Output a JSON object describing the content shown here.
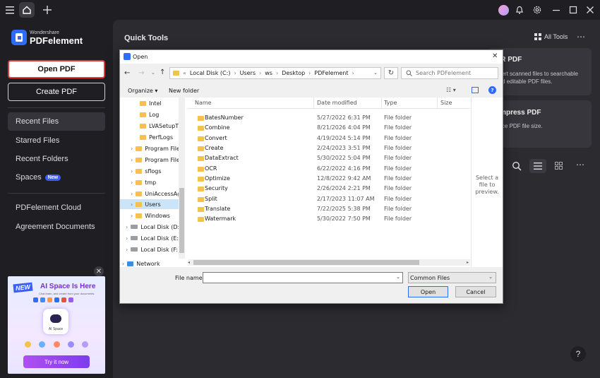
{
  "app": {
    "brand_small": "Wondershare",
    "brand_name": "PDFelement"
  },
  "sidebar": {
    "open_pdf": "Open PDF",
    "create_pdf": "Create PDF",
    "items": [
      {
        "label": "Recent Files"
      },
      {
        "label": "Starred Files"
      },
      {
        "label": "Recent Folders"
      },
      {
        "label": "Spaces"
      }
    ],
    "spaces_badge": "New",
    "items2": [
      {
        "label": "PDFelement Cloud"
      },
      {
        "label": "Agreement Documents"
      }
    ]
  },
  "promo": {
    "new_badge": "NEW",
    "title": "AI Space Is Here",
    "subtitle": "Chat learn, and create from your documents.",
    "center_label": "AI Space",
    "cta": "Try it now"
  },
  "main": {
    "quick_tools": "Quick Tools",
    "all_tools": "All Tools",
    "ocr_title": "CR PDF",
    "ocr_desc": "nvert scanned files to searchable and editable PDF files.",
    "compress_title": "ompress PDF",
    "compress_desc": "duce PDF file size."
  },
  "dialog": {
    "title": "Open",
    "breadcrumb": [
      "Local Disk (C:)",
      "Users",
      "ws",
      "Desktop",
      "PDFelement"
    ],
    "search_placeholder": "Search PDFelement",
    "organize": "Organize",
    "new_folder": "New folder",
    "columns": {
      "name": "Name",
      "date": "Date modified",
      "type": "Type",
      "size": "Size"
    },
    "tree": [
      {
        "label": "Intel",
        "kind": "folder",
        "expand": false
      },
      {
        "label": "Log",
        "kind": "folder",
        "expand": false
      },
      {
        "label": "LVASetupTm",
        "kind": "folder",
        "expand": false
      },
      {
        "label": "PerfLogs",
        "kind": "folder",
        "expand": false
      },
      {
        "label": "Program File",
        "kind": "folder",
        "expand": true
      },
      {
        "label": "Program File",
        "kind": "folder",
        "expand": true
      },
      {
        "label": "sflogs",
        "kind": "folder",
        "expand": true
      },
      {
        "label": "tmp",
        "kind": "folder",
        "expand": true
      },
      {
        "label": "UniAccessAg",
        "kind": "folder",
        "expand": true
      },
      {
        "label": "Users",
        "kind": "folder",
        "expand": true
      },
      {
        "label": "Windows",
        "kind": "folder",
        "expand": true
      },
      {
        "label": "Local Disk (D:",
        "kind": "drive",
        "expand": true
      },
      {
        "label": "Local Disk (E:)",
        "kind": "drive",
        "expand": true
      },
      {
        "label": "Local Disk (F:)",
        "kind": "drive",
        "expand": true
      },
      {
        "label": "Network",
        "kind": "network",
        "expand": true
      }
    ],
    "files": [
      {
        "name": "BatesNumber",
        "date": "5/27/2022 6:31 PM",
        "type": "File folder"
      },
      {
        "name": "Combine",
        "date": "8/21/2026 4:04 PM",
        "type": "File folder"
      },
      {
        "name": "Convert",
        "date": "4/19/2024 5:14 PM",
        "type": "File folder"
      },
      {
        "name": "Create",
        "date": "2/24/2023 3:51 PM",
        "type": "File folder"
      },
      {
        "name": "DataExtract",
        "date": "5/30/2022 5:04 PM",
        "type": "File folder"
      },
      {
        "name": "OCR",
        "date": "6/22/2022 4:16 PM",
        "type": "File folder"
      },
      {
        "name": "Optimize",
        "date": "12/8/2022 9:42 AM",
        "type": "File folder"
      },
      {
        "name": "Security",
        "date": "2/26/2024 2:21 PM",
        "type": "File folder"
      },
      {
        "name": "Split",
        "date": "2/17/2023 11:07 AM",
        "type": "File folder"
      },
      {
        "name": "Translate",
        "date": "7/22/2025 5:38 PM",
        "type": "File folder"
      },
      {
        "name": "Watermark",
        "date": "5/30/2022 7:50 PM",
        "type": "File folder"
      }
    ],
    "preview_hint": "Select a file to preview.",
    "file_name_label": "File name:",
    "file_name_value": "",
    "filter": "Common Files",
    "open_btn": "Open",
    "cancel_btn": "Cancel"
  },
  "colors": {
    "accent": "#2e6cf6",
    "highlight_border": "#e03b3b",
    "promo_cta": "#9b3df0"
  }
}
